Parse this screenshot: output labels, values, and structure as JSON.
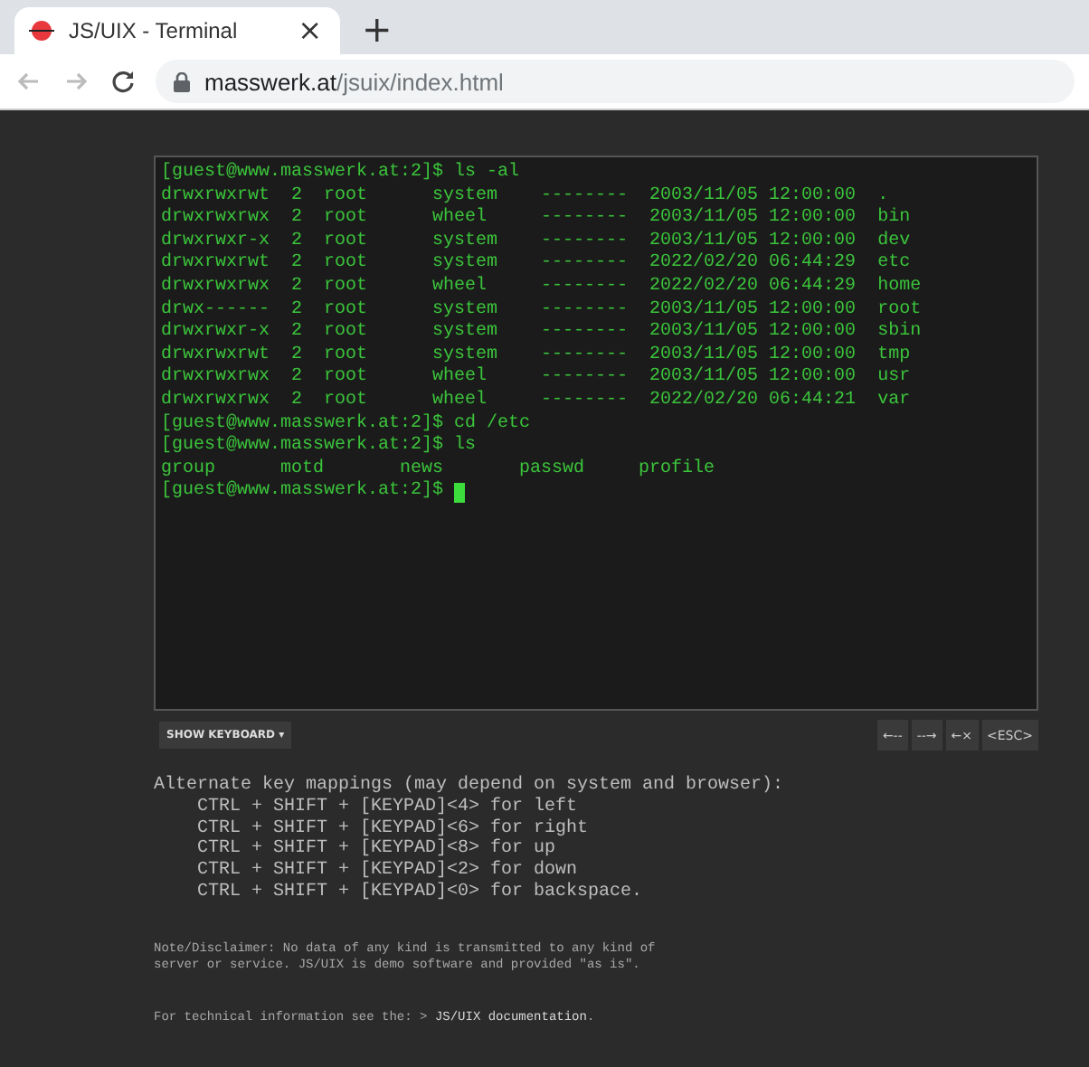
{
  "tab": {
    "title": "JS/UIX - Terminal",
    "close": "×",
    "new_tab": "+"
  },
  "address_bar": {
    "host": "masswerk.at",
    "path": "/jsuix/index.html"
  },
  "terminal": {
    "lines": [
      "[guest@www.masswerk.at:2]$ ls -al",
      "drwxrwxrwt  2  root      system    --------  2003/11/05 12:00:00  .",
      "drwxrwxrwx  2  root      wheel     --------  2003/11/05 12:00:00  bin",
      "drwxrwxr-x  2  root      system    --------  2003/11/05 12:00:00  dev",
      "drwxrwxrwt  2  root      system    --------  2022/02/20 06:44:29  etc",
      "drwxrwxrwx  2  root      wheel     --------  2022/02/20 06:44:29  home",
      "drwx------  2  root      system    --------  2003/11/05 12:00:00  root",
      "drwxrwxr-x  2  root      system    --------  2003/11/05 12:00:00  sbin",
      "drwxrwxrwt  2  root      system    --------  2003/11/05 12:00:00  tmp",
      "drwxrwxrwx  2  root      wheel     --------  2003/11/05 12:00:00  usr",
      "drwxrwxrwx  2  root      wheel     --------  2022/02/20 06:44:21  var",
      "[guest@www.masswerk.at:2]$ cd /etc",
      "[guest@www.masswerk.at:2]$ ls",
      "group      motd       news       passwd     profile"
    ],
    "prompt": "[guest@www.masswerk.at:2]$",
    "cursor": true
  },
  "keyboard_toggle": {
    "label": "SHOW KEYBOARD ▾"
  },
  "keys": [
    "←--",
    "--→",
    "←×",
    "<ESC>"
  ],
  "help": {
    "heading": "Alternate key mappings (may depend on system and browser):",
    "mappings": [
      "CTRL + SHIFT + [KEYPAD]<4> for left",
      "CTRL + SHIFT + [KEYPAD]<6> for right",
      "CTRL + SHIFT + [KEYPAD]<8> for up",
      "CTRL + SHIFT + [KEYPAD]<2> for down",
      "CTRL + SHIFT + [KEYPAD]<0> for backspace."
    ]
  },
  "disclaimer": [
    "Note/Disclaimer: No data of any kind is transmitted to any kind of",
    "server or service. JS/UIX is demo software and provided \"as is\"."
  ],
  "tech_info": {
    "text": "For technical information see the: >",
    "link": "JS/UIX documentation",
    "end": "."
  }
}
